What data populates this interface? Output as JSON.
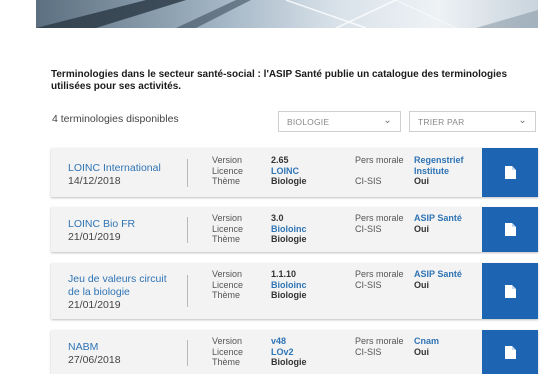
{
  "intro_text": "Terminologies dans le secteur santé-social : l'ASIP Santé publie un catalogue des terminologies utilisées pour ses activités.",
  "count_text": "4 terminologies disponibles",
  "filters": {
    "category": "BIOLOGIE",
    "sort": "TRIER PAR"
  },
  "labels": {
    "version": "Version",
    "licence": "Licence",
    "theme": "Thème",
    "pers_morale": "Pers morale",
    "cisis": "CI-SIS"
  },
  "cards": [
    {
      "title_line1": "LOINC International",
      "title_line2": "",
      "date": "14/12/2018",
      "version": "2.65",
      "licence": "LOINC",
      "theme": "Biologie",
      "org_line1": "Regenstrief",
      "org_line2": "Institute",
      "cisis": "Oui"
    },
    {
      "title_line1": "LOINC Bio FR",
      "title_line2": "",
      "date": "21/01/2019",
      "version": "3.0",
      "licence": "Bioloinc",
      "theme": "Biologie",
      "org_line1": "ASIP Santé",
      "org_line2": "",
      "cisis": "Oui"
    },
    {
      "title_line1": "Jeu de valeurs circuit",
      "title_line2": "de la biologie",
      "date": "21/01/2019",
      "version": "1.1.10",
      "licence": "Bioloinc",
      "theme": "Biologie",
      "org_line1": "ASIP Santé",
      "org_line2": "",
      "cisis": "Oui"
    },
    {
      "title_line1": "NABM",
      "title_line2": "",
      "date": "27/06/2018",
      "version": "v48",
      "licence": "LOv2",
      "theme": "Biologie",
      "org_line1": "Cnam",
      "org_line2": "",
      "cisis": "Oui"
    }
  ],
  "icons": {
    "document": "document-icon",
    "chevron": "chevron-down-icon"
  }
}
